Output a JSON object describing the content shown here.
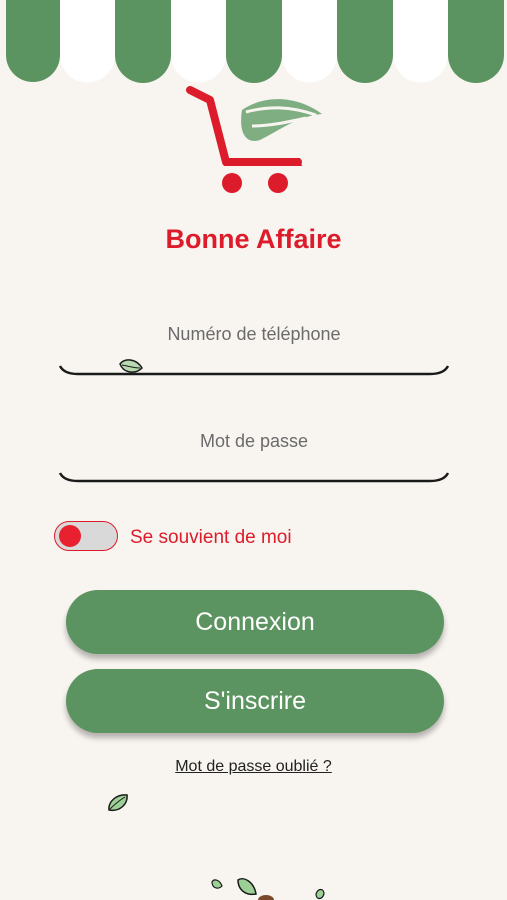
{
  "app": {
    "name": "Bonne Affaire"
  },
  "form": {
    "phone_label": "Numéro de téléphone",
    "password_label": "Mot de passe",
    "remember_label": "Se souvient de moi",
    "remember_enabled": false
  },
  "actions": {
    "login_label": "Connexion",
    "signup_label": "S'inscrire",
    "forgot_label": "Mot de passe oublié ?"
  },
  "colors": {
    "brand_red": "#dd1c2b",
    "brand_green": "#5b9460",
    "background": "#f8f4f0"
  },
  "icons": {
    "logo": "shopping-cart-leaf-icon",
    "decor": "leaf-icon"
  }
}
